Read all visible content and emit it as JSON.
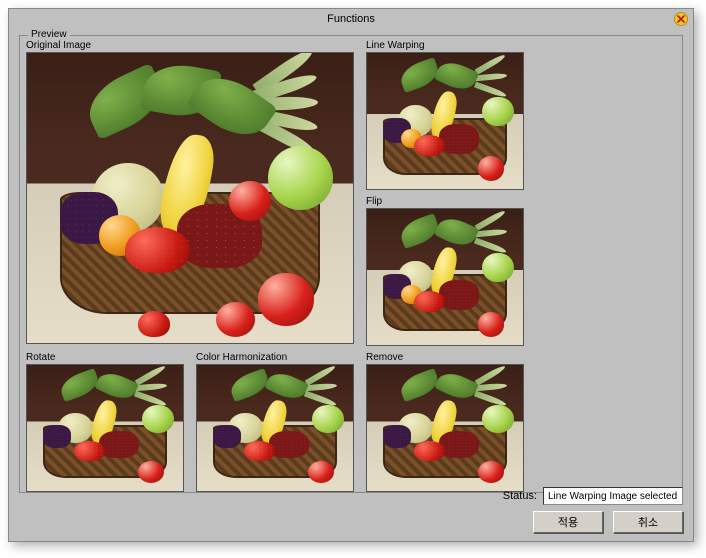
{
  "window": {
    "title": "Functions"
  },
  "preview": {
    "group_label": "Preview",
    "panels": {
      "original": {
        "label": "Original Image"
      },
      "line_warping": {
        "label": "Line Warping"
      },
      "flip": {
        "label": "Flip"
      },
      "rotate": {
        "label": "Rotate"
      },
      "color_harmonization": {
        "label": "Color Harmonization"
      },
      "remove": {
        "label": "Remove"
      }
    }
  },
  "status": {
    "label": "Status:",
    "value": "Line Warping Image selected"
  },
  "buttons": {
    "apply": "적용",
    "cancel": "취소"
  }
}
